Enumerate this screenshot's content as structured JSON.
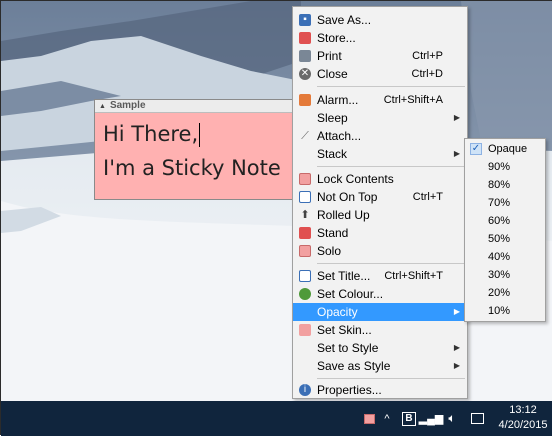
{
  "note": {
    "title": "Sample",
    "line1": "Hi There,",
    "line2": "I'm a Sticky Note",
    "color": "#ffb1b1"
  },
  "menu": {
    "items": [
      {
        "label": "Save As...",
        "shortcut": "",
        "icon": "save-icon",
        "submenu": false
      },
      {
        "label": "Store...",
        "shortcut": "",
        "icon": "store-icon",
        "submenu": false
      },
      {
        "label": "Print",
        "shortcut": "Ctrl+P",
        "icon": "print-icon",
        "submenu": false
      },
      {
        "label": "Close",
        "shortcut": "Ctrl+D",
        "icon": "close-icon",
        "submenu": false
      },
      {
        "label": "Alarm...",
        "shortcut": "Ctrl+Shift+A",
        "icon": "alarm-icon",
        "submenu": false
      },
      {
        "label": "Sleep",
        "shortcut": "",
        "icon": "",
        "submenu": true
      },
      {
        "label": "Attach...",
        "shortcut": "",
        "icon": "paperclip-icon",
        "submenu": false
      },
      {
        "label": "Stack",
        "shortcut": "",
        "icon": "",
        "submenu": true
      },
      {
        "label": "Lock Contents",
        "shortcut": "",
        "icon": "lock-icon",
        "submenu": false
      },
      {
        "label": "Not On Top",
        "shortcut": "Ctrl+T",
        "icon": "window-icon",
        "submenu": false
      },
      {
        "label": "Rolled Up",
        "shortcut": "",
        "icon": "roll-up-icon",
        "submenu": false
      },
      {
        "label": "Stand",
        "shortcut": "",
        "icon": "stand-icon",
        "submenu": false
      },
      {
        "label": "Solo",
        "shortcut": "",
        "icon": "solo-icon",
        "submenu": false
      },
      {
        "label": "Set Title...",
        "shortcut": "Ctrl+Shift+T",
        "icon": "title-icon",
        "submenu": false
      },
      {
        "label": "Set Colour...",
        "shortcut": "",
        "icon": "colour-icon",
        "submenu": false
      },
      {
        "label": "Opacity",
        "shortcut": "",
        "icon": "",
        "submenu": true
      },
      {
        "label": "Set Skin...",
        "shortcut": "",
        "icon": "skin-icon",
        "submenu": false
      },
      {
        "label": "Set to Style",
        "shortcut": "",
        "icon": "",
        "submenu": true
      },
      {
        "label": "Save as Style",
        "shortcut": "",
        "icon": "",
        "submenu": true
      },
      {
        "label": "Properties...",
        "shortcut": "",
        "icon": "info-icon",
        "submenu": false
      }
    ],
    "highlighted": "Opacity"
  },
  "opacity_menu": {
    "items": [
      "Opaque",
      "90%",
      "80%",
      "70%",
      "60%",
      "50%",
      "40%",
      "30%",
      "20%",
      "10%"
    ],
    "selected": "Opaque"
  },
  "taskbar": {
    "time": "13:12",
    "date": "4/20/2015",
    "color": "#10253d"
  },
  "colors": {
    "highlight": "#3399ff",
    "menu_bg": "#f2f2f2"
  }
}
